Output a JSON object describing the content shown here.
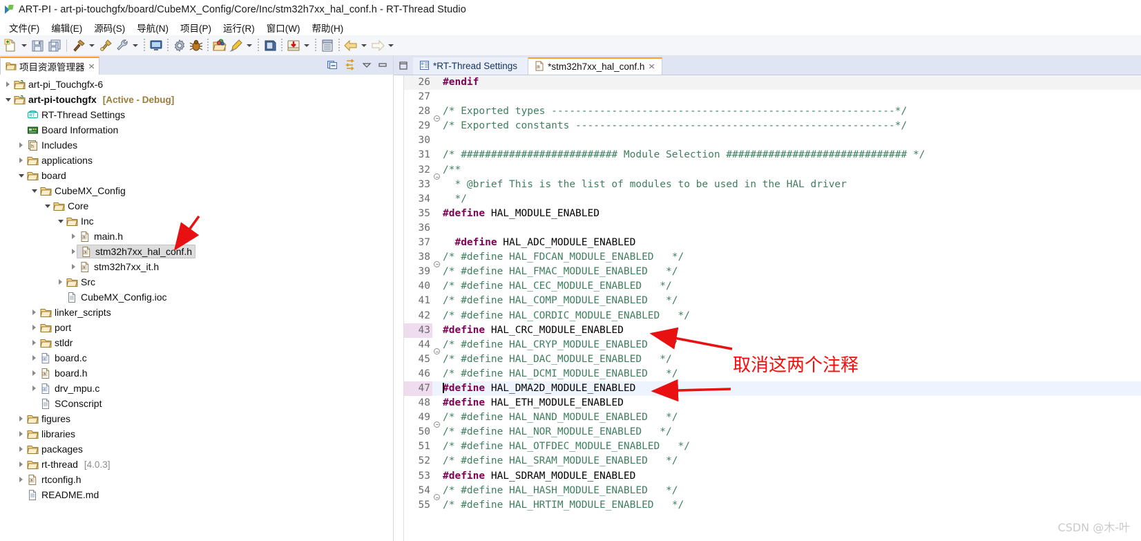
{
  "window": {
    "title": "ART-PI - art-pi-touchgfx/board/CubeMX_Config/Core/Inc/stm32h7xx_hal_conf.h - RT-Thread Studio",
    "app_icon": "rt-thread-studio-icon"
  },
  "menubar": {
    "items": [
      {
        "label": "文件(F)",
        "name": "menu-file"
      },
      {
        "label": "编辑(E)",
        "name": "menu-edit"
      },
      {
        "label": "源码(S)",
        "name": "menu-source"
      },
      {
        "label": "导航(N)",
        "name": "menu-navigate"
      },
      {
        "label": "项目(P)",
        "name": "menu-project"
      },
      {
        "label": "运行(R)",
        "name": "menu-run"
      },
      {
        "label": "窗口(W)",
        "name": "menu-window"
      },
      {
        "label": "帮助(H)",
        "name": "menu-help"
      }
    ]
  },
  "toolbar": {
    "icons": [
      "new-file-icon",
      "new-file-dropdown",
      "save-icon",
      "save-all-icon",
      "build-hammer-icon",
      "build-dropdown",
      "clean-icon",
      "settings-wrench-icon",
      "settings-dropdown",
      "terminal-icon",
      "gear-icon",
      "debug-bug-icon",
      "open-package-icon",
      "flash-download-icon",
      "flash-dropdown",
      "sdk-manager-icon",
      "import-icon",
      "import-dropdown",
      "serial-monitor-icon",
      "back-arrow-icon",
      "back-dropdown",
      "forward-arrow-icon",
      "forward-dropdown"
    ]
  },
  "explorer": {
    "tab_label": "项目资源管理器",
    "tab_close": "✕",
    "tools": [
      "collapse-all-icon",
      "link-editor-icon",
      "view-menu-icon",
      "minimize-icon"
    ],
    "tree": [
      {
        "indent": 0,
        "twisty": "collapsed",
        "icon": "project-closed-icon",
        "label": "art-pi_Touchgfx-6",
        "bold": false,
        "suffix": ""
      },
      {
        "indent": 0,
        "twisty": "expanded",
        "icon": "project-open-icon",
        "label": "art-pi-touchgfx",
        "bold": true,
        "suffix": "[Active - Debug]",
        "suffix_style": "active"
      },
      {
        "indent": 1,
        "twisty": "none",
        "icon": "rtthread-settings-icon",
        "label": "RT-Thread Settings",
        "bold": false,
        "suffix": ""
      },
      {
        "indent": 1,
        "twisty": "none",
        "icon": "board-info-icon",
        "label": "Board Information",
        "bold": false,
        "suffix": ""
      },
      {
        "indent": 1,
        "twisty": "collapsed",
        "icon": "includes-icon",
        "label": "Includes",
        "bold": false,
        "suffix": ""
      },
      {
        "indent": 1,
        "twisty": "collapsed",
        "icon": "folder-icon",
        "label": "applications",
        "bold": false,
        "suffix": ""
      },
      {
        "indent": 1,
        "twisty": "expanded",
        "icon": "folder-icon",
        "label": "board",
        "bold": false,
        "suffix": ""
      },
      {
        "indent": 2,
        "twisty": "expanded",
        "icon": "folder-icon",
        "label": "CubeMX_Config",
        "bold": false,
        "suffix": ""
      },
      {
        "indent": 3,
        "twisty": "expanded",
        "icon": "folder-icon",
        "label": "Core",
        "bold": false,
        "suffix": ""
      },
      {
        "indent": 4,
        "twisty": "expanded",
        "icon": "folder-icon",
        "label": "Inc",
        "bold": false,
        "suffix": ""
      },
      {
        "indent": 5,
        "twisty": "collapsed",
        "icon": "header-file-icon",
        "label": "main.h",
        "bold": false,
        "suffix": ""
      },
      {
        "indent": 5,
        "twisty": "collapsed",
        "icon": "header-file-icon",
        "label": "stm32h7xx_hal_conf.h",
        "bold": false,
        "suffix": "",
        "selected": true
      },
      {
        "indent": 5,
        "twisty": "collapsed",
        "icon": "header-file-icon",
        "label": "stm32h7xx_it.h",
        "bold": false,
        "suffix": ""
      },
      {
        "indent": 4,
        "twisty": "collapsed",
        "icon": "folder-icon",
        "label": "Src",
        "bold": false,
        "suffix": ""
      },
      {
        "indent": 4,
        "twisty": "none",
        "icon": "generic-file-icon",
        "label": "CubeMX_Config.ioc",
        "bold": false,
        "suffix": ""
      },
      {
        "indent": 2,
        "twisty": "collapsed",
        "icon": "folder-icon",
        "label": "linker_scripts",
        "bold": false,
        "suffix": ""
      },
      {
        "indent": 2,
        "twisty": "collapsed",
        "icon": "folder-icon",
        "label": "port",
        "bold": false,
        "suffix": ""
      },
      {
        "indent": 2,
        "twisty": "collapsed",
        "icon": "folder-icon",
        "label": "stldr",
        "bold": false,
        "suffix": ""
      },
      {
        "indent": 2,
        "twisty": "collapsed",
        "icon": "c-file-icon",
        "label": "board.c",
        "bold": false,
        "suffix": ""
      },
      {
        "indent": 2,
        "twisty": "collapsed",
        "icon": "header-file-icon",
        "label": "board.h",
        "bold": false,
        "suffix": ""
      },
      {
        "indent": 2,
        "twisty": "collapsed",
        "icon": "c-file-icon",
        "label": "drv_mpu.c",
        "bold": false,
        "suffix": ""
      },
      {
        "indent": 2,
        "twisty": "none",
        "icon": "generic-file-icon",
        "label": "SConscript",
        "bold": false,
        "suffix": ""
      },
      {
        "indent": 1,
        "twisty": "collapsed",
        "icon": "folder-icon",
        "label": "figures",
        "bold": false,
        "suffix": ""
      },
      {
        "indent": 1,
        "twisty": "collapsed",
        "icon": "folder-icon",
        "label": "libraries",
        "bold": false,
        "suffix": ""
      },
      {
        "indent": 1,
        "twisty": "collapsed",
        "icon": "folder-icon",
        "label": "packages",
        "bold": false,
        "suffix": ""
      },
      {
        "indent": 1,
        "twisty": "collapsed",
        "icon": "folder-icon",
        "label": "rt-thread",
        "bold": false,
        "suffix": "[4.0.3]",
        "suffix_style": "plain"
      },
      {
        "indent": 1,
        "twisty": "collapsed",
        "icon": "header-file-icon",
        "label": "rtconfig.h",
        "bold": false,
        "suffix": ""
      },
      {
        "indent": 1,
        "twisty": "none",
        "icon": "generic-file-icon",
        "label": "README.md",
        "bold": false,
        "suffix": ""
      }
    ]
  },
  "editor": {
    "tabs": [
      {
        "label": "*RT-Thread Settings",
        "icon": "settings-page-icon",
        "active": false,
        "closable": false
      },
      {
        "label": "*stm32h7xx_hal_conf.h",
        "icon": "header-file-icon",
        "active": true,
        "closable": true,
        "close": "✕"
      }
    ],
    "lines": [
      {
        "num": "26",
        "fold": false,
        "state": "marked",
        "segments": [
          {
            "t": "#endif",
            "c": "kw"
          }
        ]
      },
      {
        "num": "27",
        "fold": false,
        "state": "",
        "segments": [
          {
            "t": "",
            "c": "id"
          }
        ]
      },
      {
        "num": "28",
        "fold": true,
        "state": "",
        "segments": [
          {
            "t": "/* Exported types ---------------------------------------------------------*/",
            "c": "cmt"
          }
        ]
      },
      {
        "num": "29",
        "fold": false,
        "state": "",
        "segments": [
          {
            "t": "/* Exported constants -----------------------------------------------------*/",
            "c": "cmt"
          }
        ]
      },
      {
        "num": "30",
        "fold": false,
        "state": "",
        "segments": [
          {
            "t": "",
            "c": "id"
          }
        ]
      },
      {
        "num": "31",
        "fold": false,
        "state": "",
        "segments": [
          {
            "t": "/* ########################## Module Selection ############################## */",
            "c": "cmt"
          }
        ]
      },
      {
        "num": "32",
        "fold": true,
        "state": "",
        "segments": [
          {
            "t": "/**",
            "c": "cmt"
          }
        ]
      },
      {
        "num": "33",
        "fold": false,
        "state": "",
        "segments": [
          {
            "t": "  * @brief This is the list of modules to be used in the HAL driver",
            "c": "cmt"
          }
        ]
      },
      {
        "num": "34",
        "fold": false,
        "state": "",
        "segments": [
          {
            "t": "  */",
            "c": "cmt"
          }
        ]
      },
      {
        "num": "35",
        "fold": false,
        "state": "",
        "segments": [
          {
            "t": "#define",
            "c": "kw"
          },
          {
            "t": " HAL_MODULE_ENABLED",
            "c": "id"
          }
        ]
      },
      {
        "num": "36",
        "fold": false,
        "state": "",
        "segments": [
          {
            "t": "",
            "c": "id"
          }
        ]
      },
      {
        "num": "37",
        "fold": false,
        "state": "",
        "segments": [
          {
            "t": "  ",
            "c": "id"
          },
          {
            "t": "#define",
            "c": "kw"
          },
          {
            "t": " HAL_ADC_MODULE_ENABLED",
            "c": "id"
          }
        ]
      },
      {
        "num": "38",
        "fold": true,
        "state": "",
        "segments": [
          {
            "t": "/* #define HAL_FDCAN_MODULE_ENABLED   */",
            "c": "cmt"
          }
        ]
      },
      {
        "num": "39",
        "fold": false,
        "state": "",
        "segments": [
          {
            "t": "/* #define HAL_FMAC_MODULE_ENABLED   */",
            "c": "cmt"
          }
        ]
      },
      {
        "num": "40",
        "fold": false,
        "state": "",
        "segments": [
          {
            "t": "/* #define HAL_CEC_MODULE_ENABLED   */",
            "c": "cmt"
          }
        ]
      },
      {
        "num": "41",
        "fold": false,
        "state": "",
        "segments": [
          {
            "t": "/* #define HAL_COMP_MODULE_ENABLED   */",
            "c": "cmt"
          }
        ]
      },
      {
        "num": "42",
        "fold": false,
        "state": "",
        "segments": [
          {
            "t": "/* #define HAL_CORDIC_MODULE_ENABLED   */",
            "c": "cmt"
          }
        ]
      },
      {
        "num": "43",
        "fold": false,
        "state": "changed-hl",
        "segments": [
          {
            "t": "#define",
            "c": "kw"
          },
          {
            "t": " HAL_CRC_MODULE_ENABLED",
            "c": "id"
          }
        ]
      },
      {
        "num": "44",
        "fold": true,
        "state": "",
        "segments": [
          {
            "t": "/* #define HAL_CRYP_MODULE_ENABLED   */",
            "c": "cmt"
          }
        ]
      },
      {
        "num": "45",
        "fold": false,
        "state": "",
        "segments": [
          {
            "t": "/* #define HAL_DAC_MODULE_ENABLED   */",
            "c": "cmt"
          }
        ]
      },
      {
        "num": "46",
        "fold": false,
        "state": "",
        "segments": [
          {
            "t": "/* #define HAL_DCMI_MODULE_ENABLED   */",
            "c": "cmt"
          }
        ]
      },
      {
        "num": "47",
        "fold": false,
        "state": "changed-hl caret-line",
        "caret": true,
        "segments": [
          {
            "t": "#define",
            "c": "kw"
          },
          {
            "t": " HAL_DMA2D_MODULE_ENABLED",
            "c": "id"
          }
        ]
      },
      {
        "num": "48",
        "fold": false,
        "state": "",
        "segments": [
          {
            "t": "#define",
            "c": "kw"
          },
          {
            "t": " HAL_ETH_MODULE_ENABLED",
            "c": "id"
          }
        ]
      },
      {
        "num": "49",
        "fold": true,
        "state": "",
        "segments": [
          {
            "t": "/* #define HAL_NAND_MODULE_ENABLED   */",
            "c": "cmt"
          }
        ]
      },
      {
        "num": "50",
        "fold": false,
        "state": "",
        "segments": [
          {
            "t": "/* #define HAL_NOR_MODULE_ENABLED   */",
            "c": "cmt"
          }
        ]
      },
      {
        "num": "51",
        "fold": false,
        "state": "",
        "segments": [
          {
            "t": "/* #define HAL_OTFDEC_MODULE_ENABLED   */",
            "c": "cmt"
          }
        ]
      },
      {
        "num": "52",
        "fold": false,
        "state": "",
        "segments": [
          {
            "t": "/* #define HAL_SRAM_MODULE_ENABLED   */",
            "c": "cmt"
          }
        ]
      },
      {
        "num": "53",
        "fold": false,
        "state": "",
        "segments": [
          {
            "t": "#define",
            "c": "kw"
          },
          {
            "t": " HAL_SDRAM_MODULE_ENABLED",
            "c": "id"
          }
        ]
      },
      {
        "num": "54",
        "fold": true,
        "state": "",
        "segments": [
          {
            "t": "/* #define HAL_HASH_MODULE_ENABLED   */",
            "c": "cmt"
          }
        ]
      },
      {
        "num": "55",
        "fold": false,
        "state": "",
        "segments": [
          {
            "t": "/* #define HAL_HRTIM_MODULE_ENABLED   */",
            "c": "cmt"
          }
        ]
      }
    ]
  },
  "annotations": {
    "note_text": "取消这两个注释",
    "note_color": "#fb0b0b",
    "arrow_color": "#e81010",
    "arrows": [
      {
        "name": "arrow-to-tree-file"
      },
      {
        "name": "arrow-to-line-43"
      },
      {
        "name": "arrow-to-line-47"
      }
    ]
  },
  "watermark": {
    "text": "CSDN @木-叶",
    "color": "#c9c9c9"
  }
}
